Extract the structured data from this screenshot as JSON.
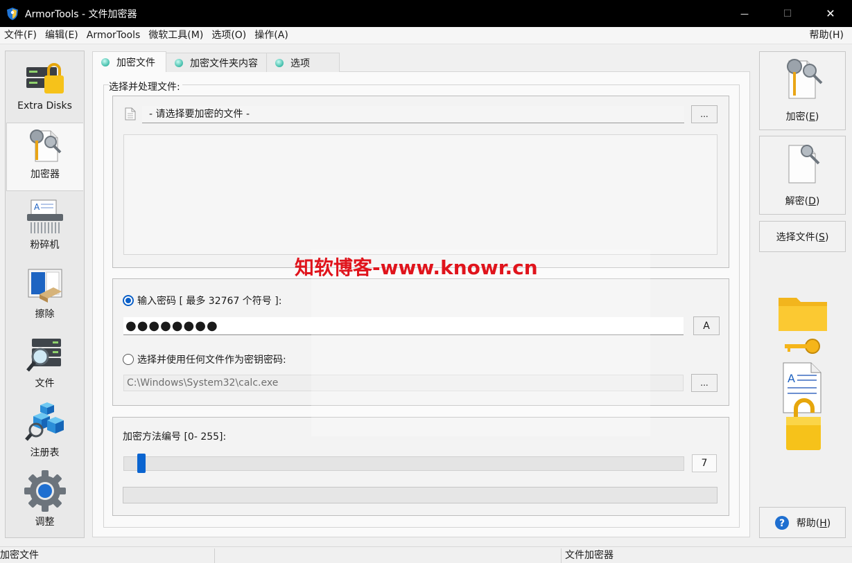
{
  "window": {
    "title": "ArmorTools - 文件加密器",
    "minimize_glyph": "—",
    "maximize_glyph": "☐",
    "close_glyph": "✕"
  },
  "menu": {
    "items": [
      "文件(F)",
      "编辑(E)",
      "ArmorTools",
      "微软工具(M)",
      "选项(O)",
      "操作(A)"
    ],
    "help": "帮助(H)"
  },
  "sidebar": {
    "items": [
      {
        "label": "Extra Disks",
        "icon": "locked-disks-icon"
      },
      {
        "label": "加密器",
        "icon": "key-document-icon"
      },
      {
        "label": "粉碎机",
        "icon": "shredder-icon"
      },
      {
        "label": "擦除",
        "icon": "eraser-book-icon"
      },
      {
        "label": "文件",
        "icon": "file-search-icon"
      },
      {
        "label": "注册表",
        "icon": "registry-icon"
      },
      {
        "label": "调整",
        "icon": "gear-icon"
      }
    ]
  },
  "tabs": [
    {
      "label": "加密文件"
    },
    {
      "label": "加密文件夹内容"
    },
    {
      "label": "选项"
    }
  ],
  "main": {
    "group_label": "选择并处理文件:",
    "file_placeholder": "- 请选择要加密的文件 -",
    "browse_label": "...",
    "password_radio_label": "输入密码 [ 最多 32767 个符号 ]:",
    "password_value": "●●●●●●●●",
    "show_password_label": "A",
    "keyfile_radio_label": "选择并使用任何文件作为密钥密码:",
    "keyfile_value": "C:\\Windows\\System32\\calc.exe",
    "keyfile_browse_label": "...",
    "method_label": "加密方法编号 [0- 255]:",
    "method_value": "7"
  },
  "watermark": "知软博客-www.knowr.cn",
  "right_panel": {
    "encrypt_label": "加密(",
    "encrypt_key": "E",
    "decrypt_label": "解密(",
    "decrypt_key": "D",
    "select_label": "选择文件(",
    "select_key": "S",
    "help_label": "帮助(",
    "help_key": "H",
    "paren_close": ")"
  },
  "status": {
    "left": "加密文件",
    "right": "文件加密器"
  },
  "colors": {
    "accent": "#0a64d0",
    "titlebar": "#000000",
    "watermark": "#e0141c"
  }
}
